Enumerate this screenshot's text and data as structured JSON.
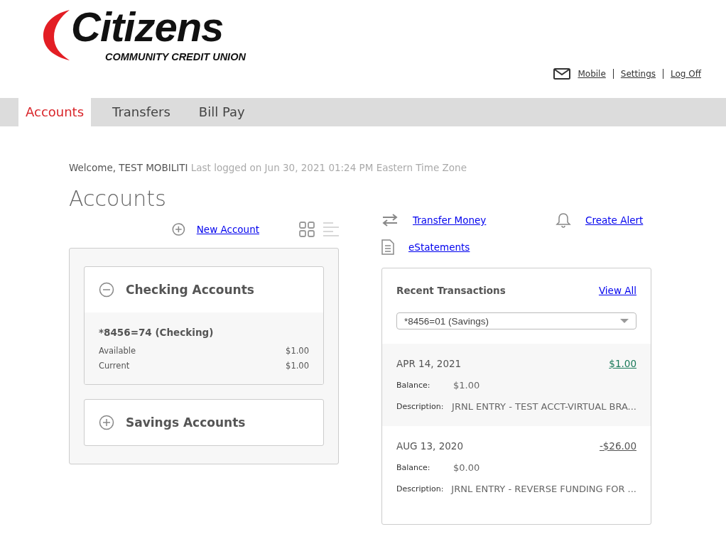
{
  "logo": {
    "name": "Citizens",
    "tagline": "COMMUNITY CREDIT UNION"
  },
  "top_links": [
    {
      "label": "Mobile"
    },
    {
      "label": "Settings"
    },
    {
      "label": "Log Off"
    }
  ],
  "tabs": [
    {
      "label": "Accounts",
      "selected": true
    },
    {
      "label": "Transfers",
      "selected": false
    },
    {
      "label": "Bill Pay",
      "selected": false
    }
  ],
  "welcome": {
    "greeting": "Welcome, TEST MOBILITI",
    "last_login": "Last logged on Jun 30, 2021 01:24 PM Eastern Time Zone"
  },
  "page_title": "Accounts",
  "new_account": "New Account",
  "view_toggle": [
    {
      "kind": "grid",
      "selected": true
    },
    {
      "kind": "list",
      "selected": false
    }
  ],
  "actions": [
    {
      "kind": "transfer",
      "label": "Transfer Money"
    },
    {
      "kind": "alert",
      "label": "Create Alert"
    },
    {
      "kind": "statement",
      "label": "eStatements"
    }
  ],
  "account_groups": [
    {
      "title": "Checking Accounts",
      "expanded": true,
      "accounts": [
        {
          "name": "*8456=74 (Checking)",
          "available_label": "Available",
          "available": "$1.00",
          "current_label": "Current",
          "current": "$1.00"
        }
      ]
    },
    {
      "title": "Savings Accounts",
      "expanded": false
    }
  ],
  "recent_transactions": {
    "title": "Recent Transactions",
    "view_all": "View All",
    "account_select": "*8456=01 (Savings)",
    "items": [
      {
        "date": "APR 14, 2021",
        "amount": "$1.00",
        "kind": "credit",
        "balance_label": "Balance:",
        "balance": "$1.00",
        "description_label": "Description:",
        "description": "JRNL ENTRY - TEST ACCT-VIRTUAL BRA..."
      },
      {
        "date": "AUG 13, 2020",
        "amount": "-$26.00",
        "kind": "debit",
        "balance_label": "Balance:",
        "balance": "$0.00",
        "description_label": "Description:",
        "description": "JRNL ENTRY - REVERSE FUNDING FOR ..."
      }
    ]
  }
}
